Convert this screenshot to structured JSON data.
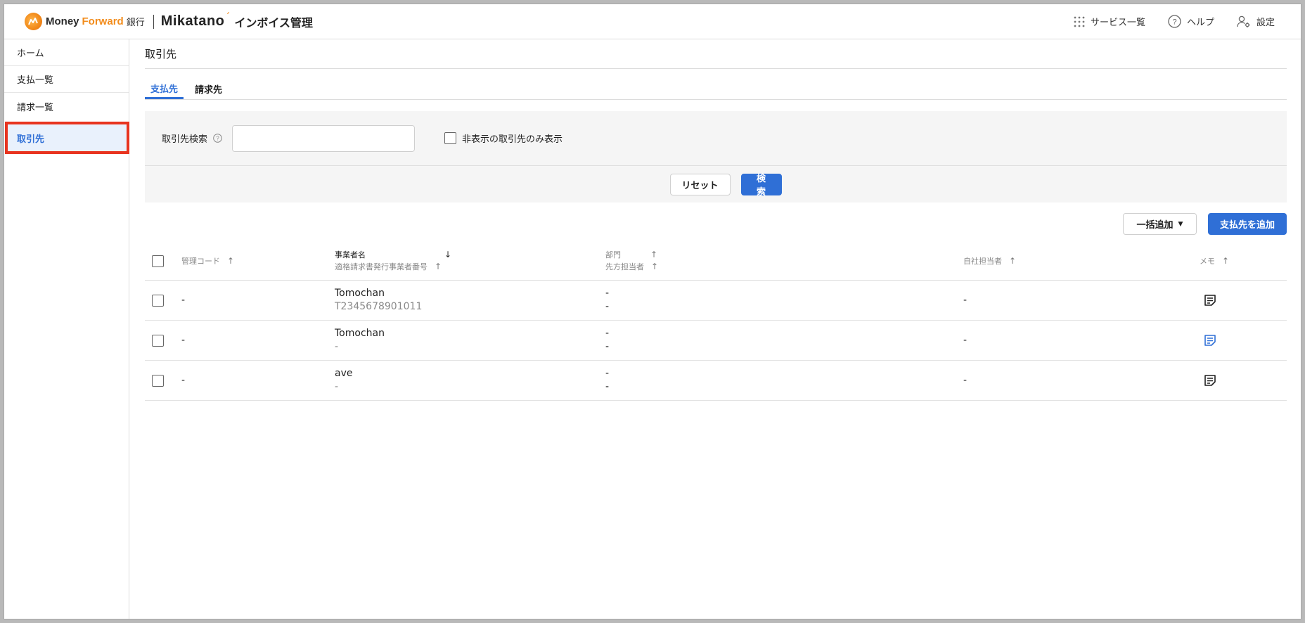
{
  "header": {
    "brand_money": "Money",
    "brand_forward": "Forward",
    "brand_bank": "銀行",
    "brand_mikatano": "Mikatano",
    "brand_product": "インボイス管理",
    "services_label": "サービス一覧",
    "help_label": "ヘルプ",
    "settings_label": "設定"
  },
  "sidebar": {
    "items": [
      {
        "label": "ホーム"
      },
      {
        "label": "支払一覧"
      },
      {
        "label": "請求一覧"
      },
      {
        "label": "取引先"
      }
    ]
  },
  "page": {
    "title": "取引先",
    "tabs": [
      {
        "label": "支払先",
        "active": true
      },
      {
        "label": "請求先",
        "active": false
      }
    ]
  },
  "filter": {
    "search_label": "取引先検索",
    "search_value": "",
    "hidden_only_label": "非表示の取引先のみ表示",
    "hidden_only_checked": false,
    "reset_label": "リセット",
    "search_button_label": "検索"
  },
  "toolbar": {
    "bulk_add_label": "一括追加",
    "add_label": "支払先を追加"
  },
  "table": {
    "columns": {
      "code": "管理コード",
      "name": "事業者名",
      "registration_number": "適格請求書発行事業者番号",
      "department": "部門",
      "counterparty_contact": "先方担当者",
      "owner": "自社担当者",
      "memo": "メモ"
    },
    "rows": [
      {
        "code": "-",
        "name": "Tomochan",
        "registration_number": "T2345678901011",
        "department": "-",
        "counterparty_contact": "-",
        "owner": "-",
        "memo_icon": "memo-icon",
        "memo_color": "#1f1f1f"
      },
      {
        "code": "-",
        "name": "Tomochan",
        "registration_number": "-",
        "department": "-",
        "counterparty_contact": "-",
        "owner": "-",
        "memo_icon": "memo-icon",
        "memo_color": "#2f6fd6"
      },
      {
        "code": "-",
        "name": "ave",
        "registration_number": "-",
        "department": "-",
        "counterparty_contact": "-",
        "owner": "-",
        "memo_icon": "memo-icon",
        "memo_color": "#1f1f1f"
      }
    ]
  },
  "colors": {
    "accent": "#2f6fd6",
    "brand_orange": "#f28c1c",
    "highlight_border": "#e8341f"
  }
}
